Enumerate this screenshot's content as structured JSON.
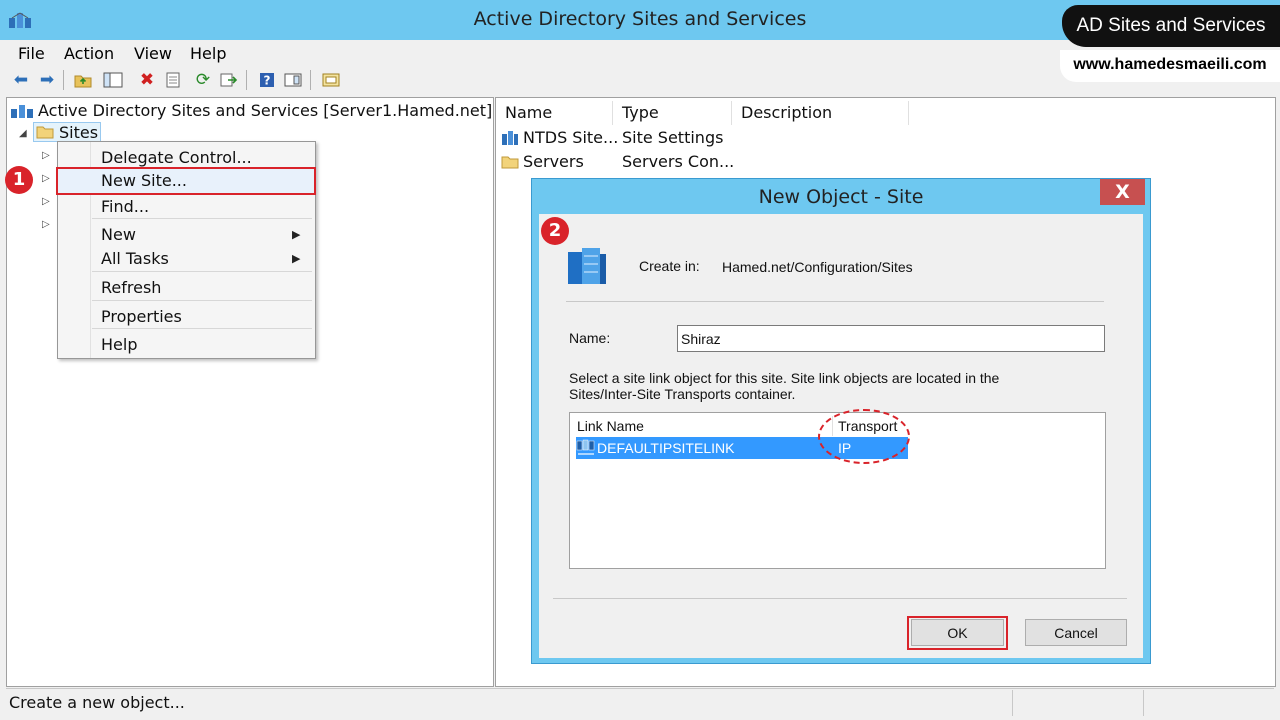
{
  "window": {
    "title": "Active Directory Sites and Services"
  },
  "branding": {
    "badge": "AD Sites and Services",
    "url": "www.hamedesmaeili.com"
  },
  "menubar": {
    "items": [
      "File",
      "Action",
      "View",
      "Help"
    ]
  },
  "toolbar": {
    "icons": [
      "back-icon",
      "forward-icon",
      "up-folder-icon",
      "show-tree-icon",
      "delete-icon",
      "properties-icon",
      "refresh-icon",
      "export-icon",
      "help-icon",
      "console-icon",
      "new-window-icon"
    ]
  },
  "tree": {
    "root": "Active Directory Sites and Services [Server1.Hamed.net]",
    "sites": "Sites"
  },
  "context_menu": {
    "items": [
      "Delegate Control...",
      "New Site...",
      "Find...",
      "New",
      "All Tasks",
      "Refresh",
      "Properties",
      "Help"
    ]
  },
  "callouts": {
    "step1": "1",
    "step2": "2"
  },
  "list": {
    "columns": [
      "Name",
      "Type",
      "Description"
    ],
    "rows": [
      {
        "name": "NTDS Site...",
        "type": "Site Settings"
      },
      {
        "name": "Servers",
        "type": "Servers Con..."
      }
    ]
  },
  "dialog": {
    "title": "New Object - Site",
    "close_label": "X",
    "create_in_label": "Create in:",
    "create_in_value": "Hamed.net/Configuration/Sites",
    "name_label": "Name:",
    "name_value": "Shiraz",
    "instructions_line1": "Select a site link object for this site. Site link objects are located in the",
    "instructions_line2": "Sites/Inter-Site Transports container.",
    "columns": [
      "Link Name",
      "Transport"
    ],
    "rows": [
      {
        "link_name": "DEFAULTIPSITELINK",
        "transport": "IP"
      }
    ],
    "ok_label": "OK",
    "cancel_label": "Cancel"
  },
  "status": {
    "text": "Create a new object..."
  },
  "colors": {
    "titlebar": "#6ec8f0",
    "highlight_red": "#d9232a",
    "selection_blue": "#3399ff"
  }
}
